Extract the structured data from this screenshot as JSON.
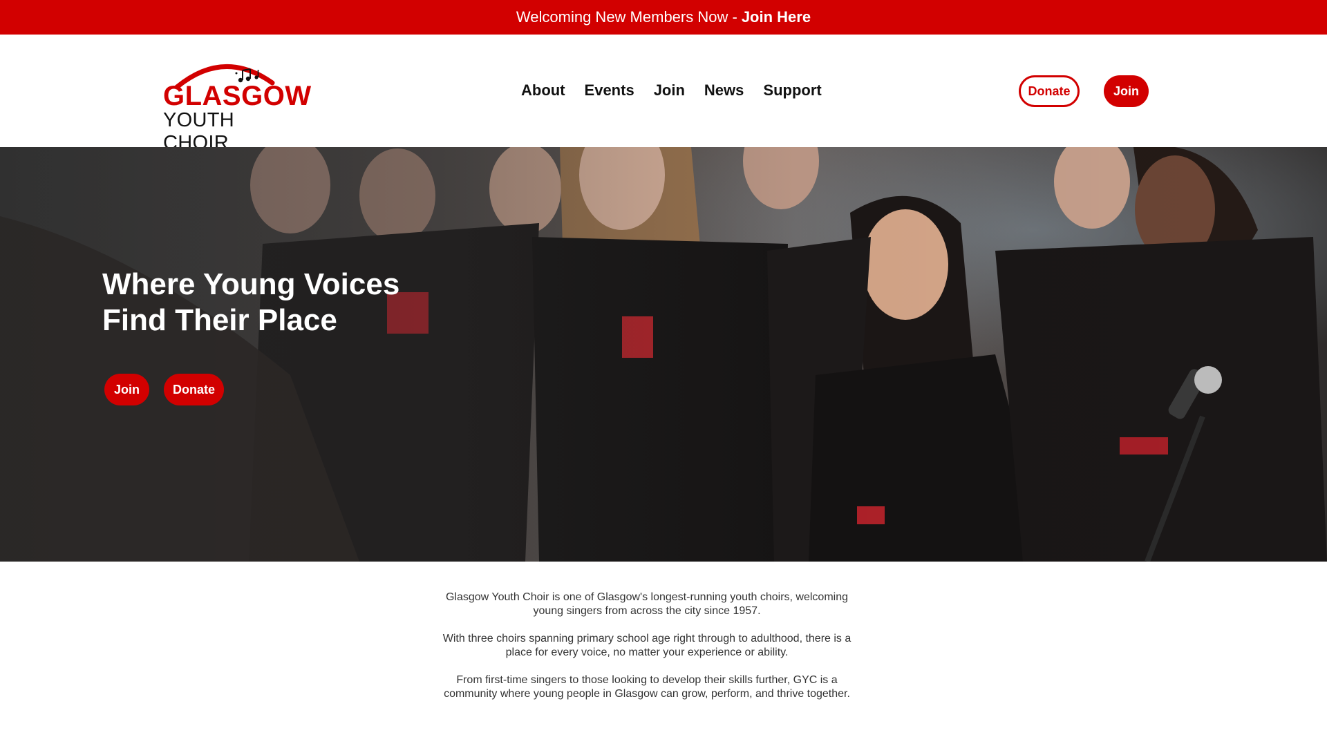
{
  "announcement": {
    "text": "Welcoming New Members Now -",
    "link_label": "Join Here"
  },
  "logo": {
    "line1": "GLASGOW",
    "line2": "YOUTH CHOIR"
  },
  "nav": {
    "items": [
      {
        "label": "About"
      },
      {
        "label": "Events"
      },
      {
        "label": "Join"
      },
      {
        "label": "News"
      },
      {
        "label": "Support"
      }
    ]
  },
  "header_actions": {
    "donate_label": "Donate",
    "join_label": "Join"
  },
  "hero": {
    "title_line1": "Where Young Voices",
    "title_line2": "Find Their Place",
    "join_label": "Join",
    "donate_label": "Donate"
  },
  "intro": {
    "paragraphs": [
      "Glasgow Youth Choir is one of Glasgow's longest-running youth choirs, welcoming young singers from across the city since 1957.",
      "With three choirs spanning primary school age right through to adulthood, there is a place for every voice, no matter your experience or ability.",
      "From first-time singers to those looking to develop their skills further, GYC is a community where young people in Glasgow can grow, perform, and thrive together."
    ]
  },
  "colors": {
    "brand_red": "#d20000",
    "text_dark": "#111111"
  },
  "icons": [
    "music-notes-icon",
    "logo-arc"
  ]
}
